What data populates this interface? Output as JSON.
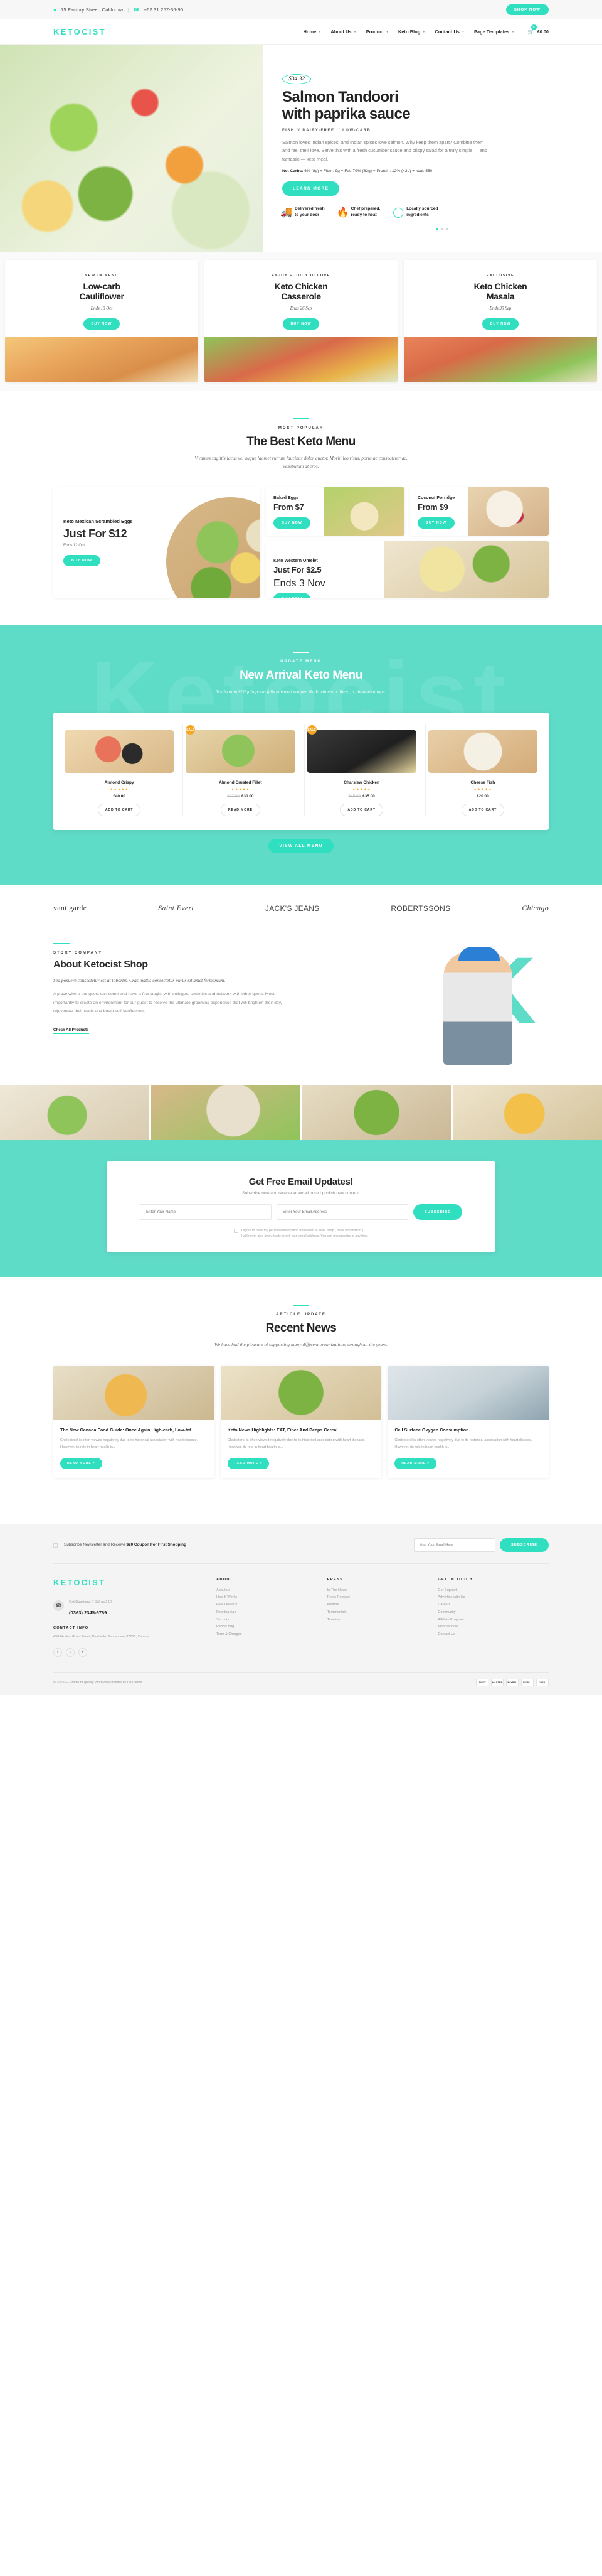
{
  "topbar": {
    "address": "15 Factory Street, California",
    "phone": "+62 31 257-36-90",
    "separator": "|",
    "shop_now": "SHOP NOW"
  },
  "nav": {
    "logo": "KETOCIST",
    "items": [
      {
        "label": "Home"
      },
      {
        "label": "About Us"
      },
      {
        "label": "Product"
      },
      {
        "label": "Keto Blog"
      },
      {
        "label": "Contact Us"
      },
      {
        "label": "Page Templates"
      }
    ],
    "cart_count": "0",
    "cart_total": "£0.00"
  },
  "hero": {
    "price": "$34.32",
    "title_line1": "Salmon Tandoori",
    "title_line2": "with paprika sauce",
    "categories": "FISH // DAIRY-FREE // LOW-CARB",
    "description": "Salmon loves Indian spices, and Indian spices love salmon. Why keep them apart? Combine them and feel their love. Serve this with a fresh cucumber sauce and crispy salad for a truly simple — and fantastic — keto meal.",
    "nutrition_label": "Net Carbs:",
    "nutrition": "6% (8g) + Fiber: 9g + Fat: 79% (62g) + Protein: 12% (42g) + kcal: 550",
    "cta": "LEARN MORE",
    "features": [
      {
        "icon": "truck-icon",
        "line1": "Delivered fresh",
        "line2": "to your door"
      },
      {
        "icon": "flame-icon",
        "line1": "Chef prepared,",
        "line2": "ready to heat"
      },
      {
        "icon": "location-pin-icon",
        "line1": "Locally sourced",
        "line2": "ingredients"
      }
    ]
  },
  "promos": [
    {
      "kicker": "NEW IN MENU",
      "title_line1": "Low-carb",
      "title_line2": "Cauliflower",
      "ends": "Ends 10 Oct",
      "cta": "BUY NOW"
    },
    {
      "kicker": "ENJOY FOOD YOU LOVE",
      "title_line1": "Keto Chicken",
      "title_line2": "Casserole",
      "ends": "Ends 26 Sep",
      "cta": "BUY NOW"
    },
    {
      "kicker": "EXCLUSIVE",
      "title_line1": "Keto Chicken",
      "title_line2": "Masala",
      "ends": "Ends 30 Sep",
      "cta": "BUY NOW"
    }
  ],
  "best_menu": {
    "kicker": "MOST POPULAR",
    "title": "The Best Keto Menu",
    "subtitle": "Vivamus sagittis lacus vel augue laoreet rutrum faucibus dolor auctor. Morbi leo risus, porta ac consectetur ac, vestibulum at eros.",
    "feature": {
      "name": "Keto Mexican Scrambled Eggs",
      "price": "Just For $12",
      "ends": "Ends 12 Oct",
      "cta": "BUY NOW"
    },
    "cards": [
      {
        "name": "Baked Eggs",
        "price": "From $7",
        "cta": "BUY NOW"
      },
      {
        "name": "Coconut Porridge",
        "price": "From $9",
        "cta": "BUY NOW"
      },
      {
        "name": "Keto Western Omelet",
        "price": "Just For $2.5",
        "ends": "Ends 3 Nov",
        "cta": "BUY NOW"
      }
    ]
  },
  "arrival": {
    "watermark": "Ketocist",
    "kicker": "UPDATE MENU",
    "title": "New Arrival Keto Menu",
    "subtitle": "Vestibulum id ligula porta felis euismod semper. Nulla vitae elit libero, a pharetra augue.",
    "products": [
      {
        "badge": "",
        "name": "Almond Crispy",
        "stars": "★★★★★",
        "old_price": "",
        "price": "£40.00",
        "cta": "ADD TO CART"
      },
      {
        "badge": "SALE",
        "name": "Almond Crusted Fillet",
        "stars": "★★★★★",
        "old_price": "£47.00",
        "price": "£30.00",
        "cta": "READ MORE"
      },
      {
        "badge": "SALE",
        "name": "Charsiew Chicken",
        "stars": "★★★★★",
        "old_price": "£45.00",
        "price": "£35.00",
        "cta": "ADD TO CART"
      },
      {
        "badge": "",
        "name": "Cheese Fish",
        "stars": "★★★★★",
        "old_price": "",
        "price": "£20.00",
        "cta": "ADD TO CART"
      }
    ],
    "view_all": "VIEW ALL MENU"
  },
  "brands": [
    {
      "name": "vant garde"
    },
    {
      "name": "Saint Evert"
    },
    {
      "name": "JACK'S JEANS"
    },
    {
      "name": "ROBERTSSONS"
    },
    {
      "name": "Chicago"
    }
  ],
  "about": {
    "kicker": "STORY COMPANY",
    "title": "About Ketocist Shop",
    "lead": "Sed posuere consectetur est at lobortis. Cras mattis consectetur purus sit amet fermentum.",
    "body": "A place where our guest can come and have a few laughs with colleges, societies and network with other guest. Most importantly to create an environment for our guest to receive the ultimate grooming experience that will brighten their day, rejuvenate their souls and boost self-confidence.",
    "link": "Check All Products",
    "big_letter": "K"
  },
  "newsletter": {
    "title": "Get Free Email Updates!",
    "subtitle": "Subscribe now and receive an email once I publish new content.",
    "name_placeholder": "Enter Your Name",
    "email_placeholder": "Enter Your Email Address",
    "cta": "SUBSCRIBE",
    "consent_line1": "I agree to have my personal information transfered to MailChimp ( more information )",
    "consent_line2": "I will never give away, trade or sell your email address. You can unsubscribe at any time."
  },
  "news": {
    "kicker": "ARTICLE UPDATE",
    "title": "Recent News",
    "subtitle": "We have had the pleasure of supporting many different organizations throughout the years.",
    "items": [
      {
        "title": "The New Canada Food Guide: Once Again High-carb, Low-fat",
        "desc": "Cholesterol is often viewed negatively due to its historical association with heart disease. However, its role in heart health is...",
        "cta": "READ MORE >"
      },
      {
        "title": "Keto News Highlights: EAT, Fiber And Peeps Cereal",
        "desc": "Cholesterol is often viewed negatively due to its historical association with heart disease. However, its role in heart health is...",
        "cta": "READ MORE >"
      },
      {
        "title": "Cell Surface Oxygen Consumption",
        "desc": "Cholesterol is often viewed negatively due to its historical association with heart disease. However, its role in heart health is...",
        "cta": "READ MORE >"
      }
    ]
  },
  "footer": {
    "subscribe_text_pre": "Subscribe Newsletter and Receive ",
    "subscribe_text_bold": "$20 Coupon For First Shopping",
    "email_placeholder": "Your Your Email Here",
    "subscribe_cta": "SUBSCRIBE",
    "logo": "KETOCIST",
    "support_label": "Got Questions ? Call us 24/7",
    "support_phone": "(0363) 2345-6789",
    "contact_heading": "CONTACT INFO",
    "contact_address": "458 Hidden Road Road, Nashville, Tennessee 37233, Zambia",
    "socials": [
      "facebook-icon",
      "twitter-icon",
      "instagram-icon"
    ],
    "columns": [
      {
        "heading": "ABOUT",
        "links": [
          "About us",
          "How It Works",
          "Free Delivery",
          "Desktop App",
          "Security",
          "Report Bug",
          "Term & Charges"
        ]
      },
      {
        "heading": "PRESS",
        "links": [
          "In The News",
          "Press Release",
          "Awards",
          "Testimonials",
          "Timeline"
        ]
      },
      {
        "heading": "GET IN TOUCH",
        "links": [
          "Get Support",
          "Advertise with Us",
          "Careers",
          "Community",
          "Affiliate Program",
          "Merchandise",
          "Contact Us"
        ]
      }
    ],
    "copyright": "© 2019 — Premium quality WordPress theme by DeTheme",
    "payments": [
      "AMEX",
      "MASTER",
      "PAYPAL",
      "SKRILL",
      "VISA"
    ]
  },
  "colors": {
    "accent": "#2fdfc0",
    "band": "#5fdcc8",
    "star": "#f5a623",
    "text": "#232323"
  }
}
